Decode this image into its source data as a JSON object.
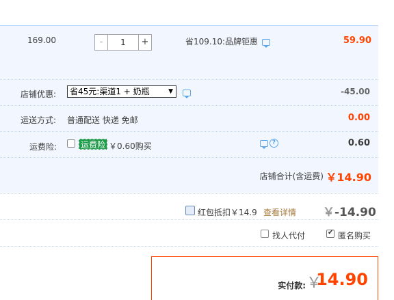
{
  "item": {
    "unit_price": "169.00",
    "quantity": {
      "minus": "-",
      "value": "1",
      "plus": "+"
    },
    "promo_text": "省109.10:品牌钜惠",
    "total": "59.90"
  },
  "shop_discount": {
    "label": "店铺优惠:",
    "selected_option": "省45元:渠道1 + 奶瓶",
    "arrow": "▼",
    "amount": "-45.00"
  },
  "shipping": {
    "label": "运送方式:",
    "method": "普通配送 快递 免邮",
    "fee": "0.00"
  },
  "insurance": {
    "label": "运费险:",
    "tag": "运费险",
    "price_text": "￥0.60购买",
    "help": "?",
    "amount": "0.60"
  },
  "shop_total": {
    "label": "店铺合计(含运费)",
    "value": "￥14.90"
  },
  "red_packet": {
    "label": "红包抵扣￥14.9",
    "detail_link": "查看详情",
    "yen": "￥",
    "amount": "-14.90"
  },
  "options": {
    "pay_for_me": "找人代付",
    "anonymous": "匿名购买"
  },
  "payment": {
    "label": "实付款:",
    "yen": "￥",
    "value": "14.90"
  },
  "colors": {
    "accent": "#ff4400",
    "panel_bg": "#f2f7ff",
    "insurance_tag": "#1e9c4a",
    "link": "#a5773a"
  }
}
